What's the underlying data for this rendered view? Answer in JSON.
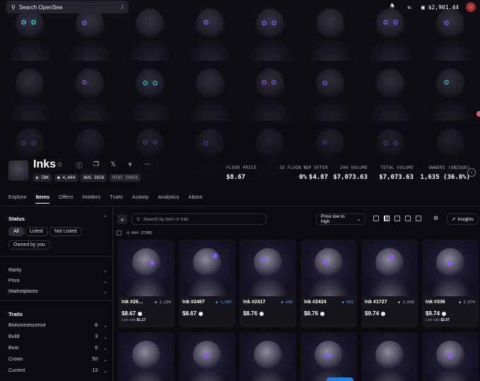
{
  "topbar": {
    "search_placeholder": "Search OpenSea",
    "search_shortcut": "/",
    "balance": "$2,901.44",
    "icons": [
      "bell-icon",
      "swap-icon",
      "wallet-icon",
      "chevron-down-icon"
    ]
  },
  "collection": {
    "name": "Inks",
    "tags": [
      "INK",
      "4,444",
      "AUG 2026",
      "MINT ENDED"
    ],
    "stats": [
      {
        "label": "FLOOR PRICE",
        "value": "$8.67"
      },
      {
        "label": "1D FLOOR %",
        "value": "0%"
      },
      {
        "label": "TOP OFFER",
        "value": "$4.87"
      },
      {
        "label": "24H VOLUME",
        "value": "$7,073.63"
      },
      {
        "label": "TOTAL VOLUME",
        "value": "$7,073.63"
      },
      {
        "label": "OWNERS (UNIQUE)",
        "value": "1,635 (36.8%)"
      }
    ]
  },
  "tabs": [
    "Explore",
    "Items",
    "Offers",
    "Holders",
    "Traits",
    "Activity",
    "Analytics",
    "About"
  ],
  "active_tab": "Items",
  "sidebar": {
    "status_title": "Status",
    "status_chips": [
      "All",
      "Listed",
      "Not Listed",
      "Owned by you"
    ],
    "filters": [
      "Rarity",
      "Price",
      "Marketplaces"
    ],
    "traits_title": "Traits",
    "traits": [
      {
        "name": "Bioluminescence",
        "count": "8"
      },
      {
        "name": "Build",
        "count": "3"
      },
      {
        "name": "Bust",
        "count": "6"
      },
      {
        "name": "Crown",
        "count": "50"
      },
      {
        "name": "Current",
        "count": "13"
      }
    ]
  },
  "toolbar": {
    "search_placeholder": "Search by item or trait",
    "sort_label": "Price low to high",
    "insights_label": "Insights",
    "items_count": "4,444 ITEMS"
  },
  "cards": [
    {
      "name": "Ink #26…",
      "rank": "2,294",
      "rank_highlight": false,
      "price": "$8.67",
      "last_sale_label": "Last sale",
      "last_sale": "$1.17"
    },
    {
      "name": "Ink #2467",
      "rank": "1,087",
      "rank_highlight": true,
      "price": "$8.67",
      "last_sale_label": "",
      "last_sale": ""
    },
    {
      "name": "Ink #2417",
      "rank": "688",
      "rank_highlight": true,
      "price": "$8.76",
      "last_sale_label": "",
      "last_sale": ""
    },
    {
      "name": "Ink #2424",
      "rank": "503",
      "rank_highlight": true,
      "price": "$8.76",
      "last_sale_label": "",
      "last_sale": ""
    },
    {
      "name": "Ink #1727",
      "rank": "3,840",
      "rank_highlight": false,
      "price": "$9.74",
      "last_sale_label": "",
      "last_sale": ""
    },
    {
      "name": "Ink #336",
      "rank": "2,674",
      "rank_highlight": false,
      "price": "$9.74",
      "last_sale_label": "Last sale",
      "last_sale": "$2.07"
    }
  ]
}
